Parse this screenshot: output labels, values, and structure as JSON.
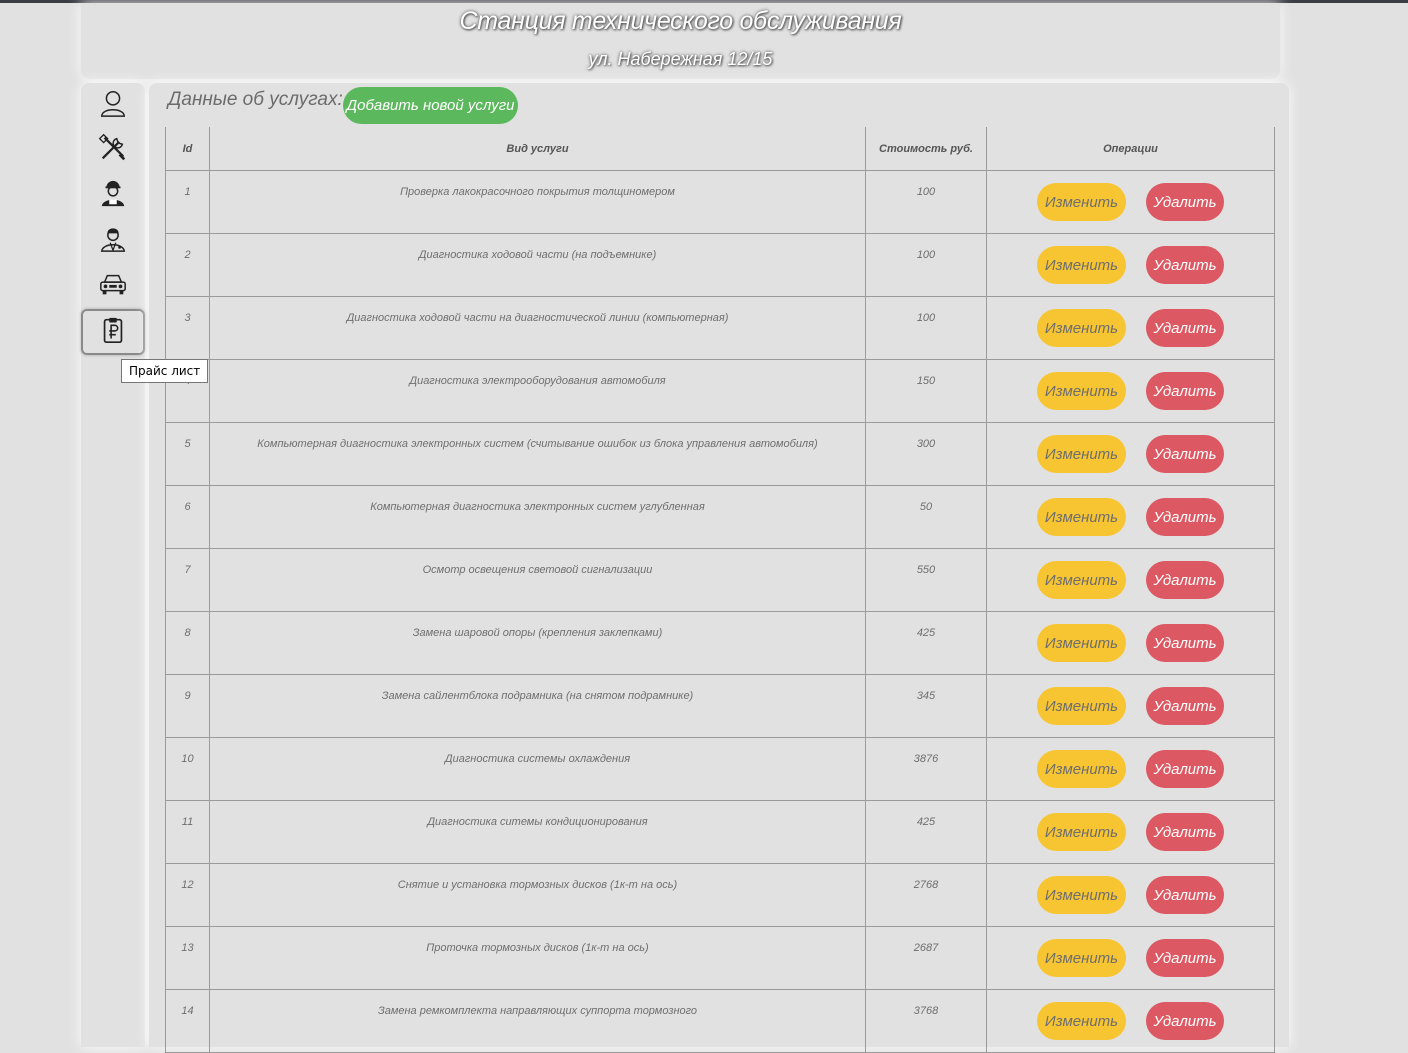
{
  "header": {
    "title": "Станция технического обслуживания",
    "address": "ул. Набережная 12/15"
  },
  "sidebar": {
    "items": [
      {
        "icon": "user-icon"
      },
      {
        "icon": "tools-icon"
      },
      {
        "icon": "mechanic-icon"
      },
      {
        "icon": "employee-icon"
      },
      {
        "icon": "car-icon"
      },
      {
        "icon": "price-list-icon",
        "active": true
      }
    ],
    "tooltip": "Прайс лист"
  },
  "main": {
    "section_title": "Данные об услугах:",
    "add_button": "Добавить новой услуги",
    "table": {
      "columns": [
        "Id",
        "Вид услуги",
        "Стоимость руб.",
        "Операции"
      ],
      "edit_label": "Изменить",
      "delete_label": "Удалить",
      "rows": [
        {
          "id": "1",
          "name": "Проверка лакокрасочного покрытия толщиномером",
          "price": "100"
        },
        {
          "id": "2",
          "name": "Диагностика ходовой части (на подъемнике)",
          "price": "100"
        },
        {
          "id": "3",
          "name": "Диагностика ходовой части на диагностической линии (компьютерная)",
          "price": "100"
        },
        {
          "id": "4",
          "name": "Диагностика электрооборудования автомобиля",
          "price": "150"
        },
        {
          "id": "5",
          "name": "Компьютерная диагностика электронных систем (считывание ошибок из блока управления автомобиля)",
          "price": "300"
        },
        {
          "id": "6",
          "name": "Компьютерная диагностика электронных систем углубленная",
          "price": "50"
        },
        {
          "id": "7",
          "name": "Осмотр освещения световой сигнализации",
          "price": "550"
        },
        {
          "id": "8",
          "name": "Замена шаровой опоры (крепления заклепками)",
          "price": "425"
        },
        {
          "id": "9",
          "name": "Замена сайлентблока подрамника (на снятом подрамнике)",
          "price": "345"
        },
        {
          "id": "10",
          "name": "Диагностика системы охлаждения",
          "price": "3876"
        },
        {
          "id": "11",
          "name": "Диагностика ситемы кондиционирования",
          "price": "425"
        },
        {
          "id": "12",
          "name": "Снятие и установка тормозных дисков (1к-т на ось)",
          "price": "2768"
        },
        {
          "id": "13",
          "name": "Проточка тормозных дисков (1к-т на ось)",
          "price": "2687"
        },
        {
          "id": "14",
          "name": "Замена ремкомплекта направляющих суппорта тормозного",
          "price": "3768"
        }
      ]
    }
  },
  "colors": {
    "background": "#e1e1e1",
    "add_button": "#5cb85c",
    "edit_button": "#f8c532",
    "delete_button": "#dc5862"
  }
}
